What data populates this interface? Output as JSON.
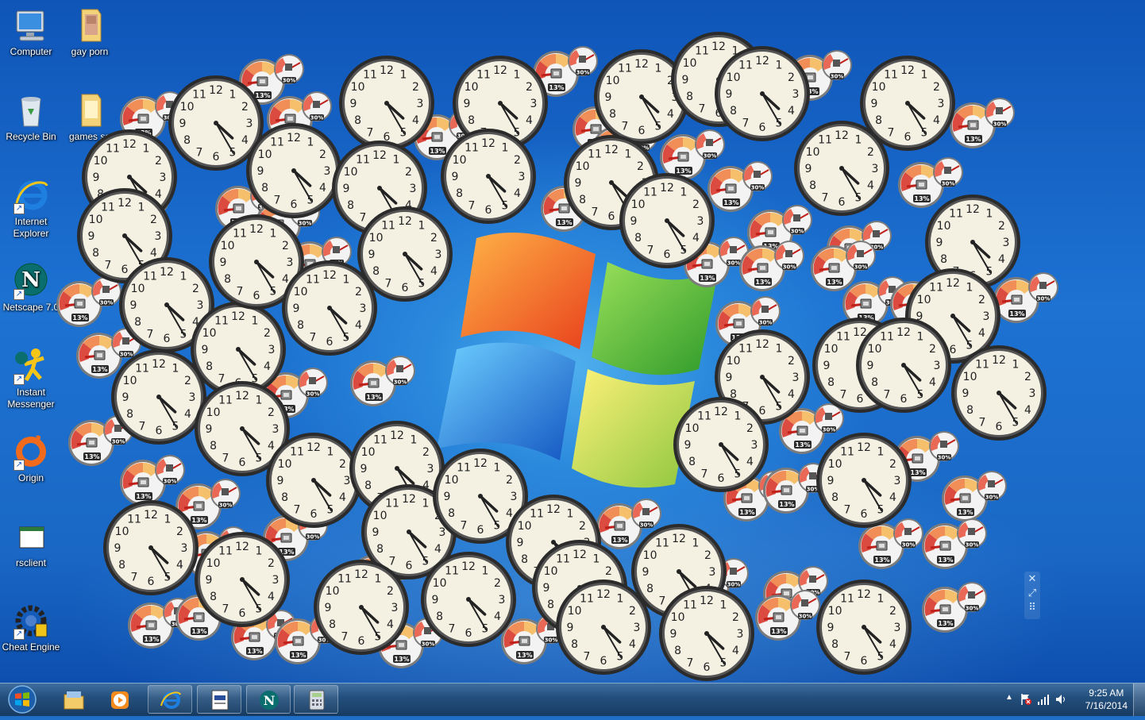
{
  "desktop_icons": [
    {
      "label": "Computer",
      "icon": "computer-icon"
    },
    {
      "label": "gay porn",
      "icon": "folder-icon"
    },
    {
      "label": "Recycle Bin",
      "icon": "recycle-bin-icon"
    },
    {
      "label": "games sa",
      "icon": "folder-icon"
    },
    {
      "label": "Internet Explorer",
      "icon": "internet-explorer-icon"
    },
    {
      "label": "Netscape 7.0",
      "icon": "netscape-icon"
    },
    {
      "label": "Instant Messenger",
      "icon": "instant-messenger-icon"
    },
    {
      "label": "Origin",
      "icon": "origin-icon"
    },
    {
      "label": "rsclient",
      "icon": "application-icon"
    },
    {
      "label": "Cheat Engine",
      "icon": "cheat-engine-icon"
    }
  ],
  "gadgets": {
    "cpu_meter_small_dial": "13%",
    "cpu_meter_large_dial": "30%",
    "clock_time": "4:25"
  },
  "gadget_controls": [
    "close-icon",
    "resize-icon",
    "drag-grip-icon"
  ],
  "taskbar": {
    "pinned": [
      "start-orb",
      "windows-explorer-icon",
      "media-player-icon",
      "internet-explorer-icon",
      "document-icon",
      "netscape-icon",
      "calculator-icon"
    ]
  },
  "tray": {
    "time": "9:25 AM",
    "date": "7/16/2014"
  },
  "colors": {
    "desktop_blue": "#1d72d2",
    "clock_face": "#f4f1e3",
    "meter_red": "#d8382c"
  }
}
